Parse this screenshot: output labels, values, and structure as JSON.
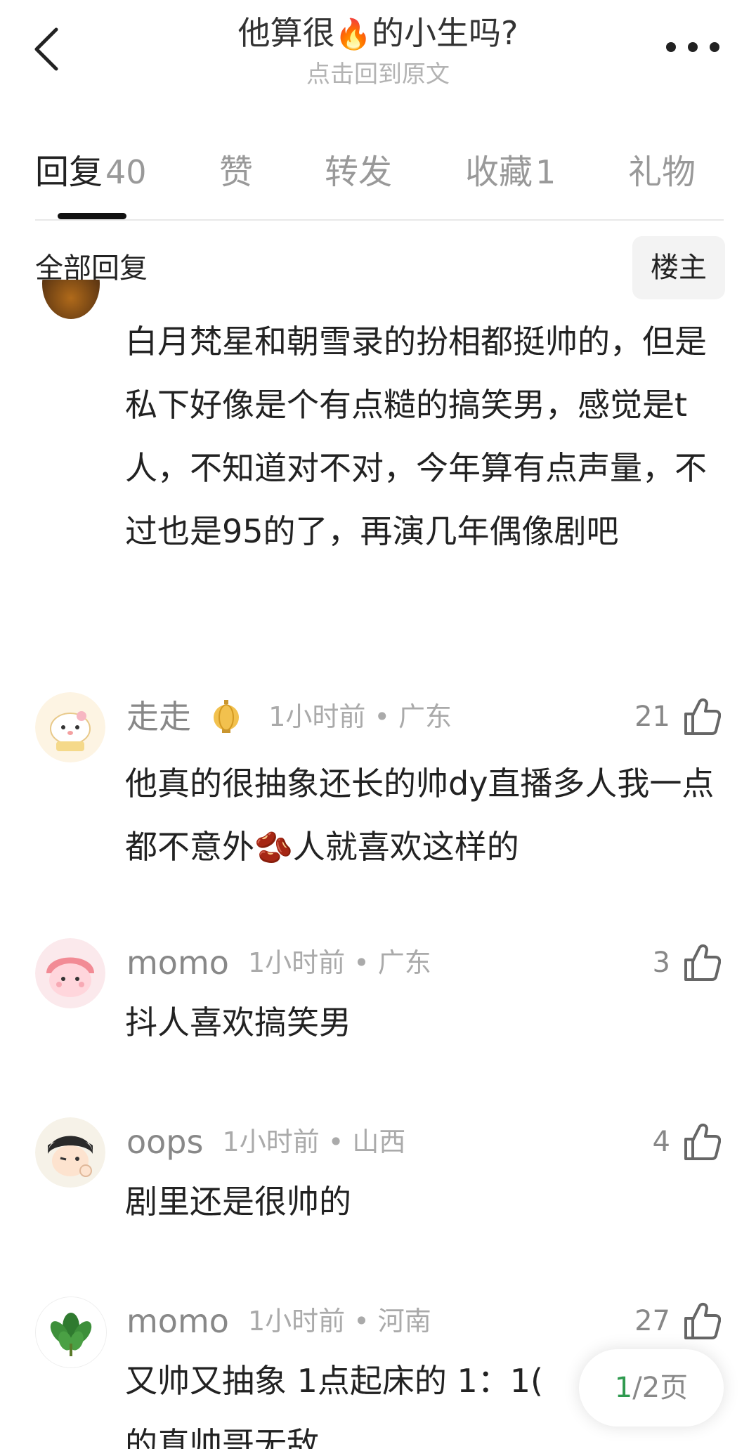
{
  "header": {
    "title_before": "他算很",
    "title_emoji": "🔥",
    "title_after": "的小生吗?",
    "subtitle": "点击回到原文"
  },
  "tabs": [
    {
      "label": "回复",
      "count": "40"
    },
    {
      "label": "赞",
      "count": ""
    },
    {
      "label": "转发",
      "count": ""
    },
    {
      "label": "收藏",
      "count": "1"
    },
    {
      "label": "礼物",
      "count": ""
    }
  ],
  "filter": {
    "label": "全部回复",
    "owner_button": "楼主"
  },
  "top_comment": {
    "text": "白月梵星和朝雪录的扮相都挺帅的，但是私下好像是个有点糙的搞笑男，感觉是t人，不知道对不对，今年算有点声量，不过也是95的了，再演几年偶像剧吧"
  },
  "comments": [
    {
      "username": "走走",
      "time": "1小时前",
      "location": "广东",
      "likes": "21",
      "text_before": "他真的很抽象还长的帅dy直播多人我一点都不意外",
      "emoji": "🫘",
      "text_after": "人就喜欢这样的"
    },
    {
      "username": "momo",
      "time": "1小时前",
      "location": "广东",
      "likes": "3",
      "text": "抖人喜欢搞笑男"
    },
    {
      "username": "oops",
      "time": "1小时前",
      "location": "山西",
      "likes": "4",
      "text": "剧里还是很帅的"
    },
    {
      "username": "momo",
      "time": "1小时前",
      "location": "河南",
      "likes": "27",
      "text": "又帅又抽象 1点起床的 1：1(",
      "text_line2": "的真帅哥无敌"
    }
  ],
  "meta_separator": "•",
  "pager": {
    "current": "1",
    "total_text": "/2页"
  },
  "colors": {
    "pager_current": "#2f9a4f",
    "muted_text": "#888888",
    "body_text": "#222222"
  }
}
